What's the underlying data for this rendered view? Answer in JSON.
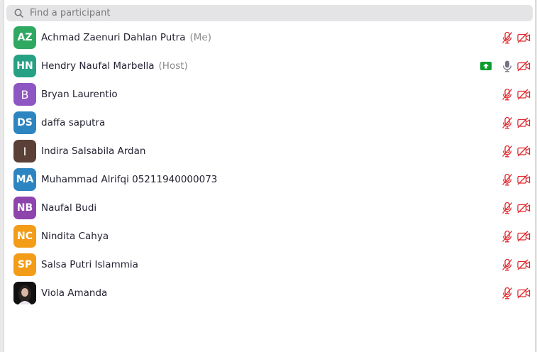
{
  "search": {
    "placeholder": "Find a participant",
    "value": ""
  },
  "participants": [
    {
      "initials": "AZ",
      "name": "Achmad Zaenuri Dahlan Putra",
      "role": "(Me)",
      "avatar_color": "#2fa862",
      "avatar_style": "initials",
      "sharing": false,
      "mic": "muted",
      "video": "off"
    },
    {
      "initials": "HN",
      "name": "Hendry Naufal Marbella",
      "role": "(Host)",
      "avatar_color": "#27a184",
      "avatar_style": "initials",
      "sharing": true,
      "mic": "on",
      "video": "off"
    },
    {
      "initials": "B",
      "name": "Bryan Laurentio",
      "role": "",
      "avatar_color": "#8e56c2",
      "avatar_style": "single",
      "sharing": false,
      "mic": "muted",
      "video": "off"
    },
    {
      "initials": "DS",
      "name": "daffa saputra",
      "role": "",
      "avatar_color": "#2c85c0",
      "avatar_style": "initials",
      "sharing": false,
      "mic": "muted",
      "video": "off"
    },
    {
      "initials": "I",
      "name": "Indira Salsabila Ardan",
      "role": "",
      "avatar_color": "#5a4036",
      "avatar_style": "single",
      "sharing": false,
      "mic": "muted",
      "video": "off"
    },
    {
      "initials": "MA",
      "name": "Muhammad Alrifqi 05211940000073",
      "role": "",
      "avatar_color": "#2c85c0",
      "avatar_style": "initials",
      "sharing": false,
      "mic": "muted",
      "video": "off"
    },
    {
      "initials": "NB",
      "name": "Naufal Budi",
      "role": "",
      "avatar_color": "#8e44ad",
      "avatar_style": "initials",
      "sharing": false,
      "mic": "muted",
      "video": "off"
    },
    {
      "initials": "NC",
      "name": "Nindita Cahya",
      "role": "",
      "avatar_color": "#f39c17",
      "avatar_style": "initials",
      "sharing": false,
      "mic": "muted",
      "video": "off"
    },
    {
      "initials": "SP",
      "name": "Salsa Putri Islammia",
      "role": "",
      "avatar_color": "#f39c17",
      "avatar_style": "initials",
      "sharing": false,
      "mic": "muted",
      "video": "off"
    },
    {
      "initials": "",
      "name": "Viola Amanda",
      "role": "",
      "avatar_color": "#1a1a1a",
      "avatar_style": "photo",
      "sharing": false,
      "mic": "muted",
      "video": "off"
    }
  ],
  "colors": {
    "muted_red": "#e0282e",
    "mic_gray": "#747487",
    "share_green": "#0b9d2b",
    "search_bg": "#e4e4e6"
  },
  "icon_names": {
    "mic_muted": "mic-muted-icon",
    "mic_on": "mic-icon",
    "video_off": "video-off-icon",
    "share": "share-screen-icon",
    "search": "search-icon"
  }
}
